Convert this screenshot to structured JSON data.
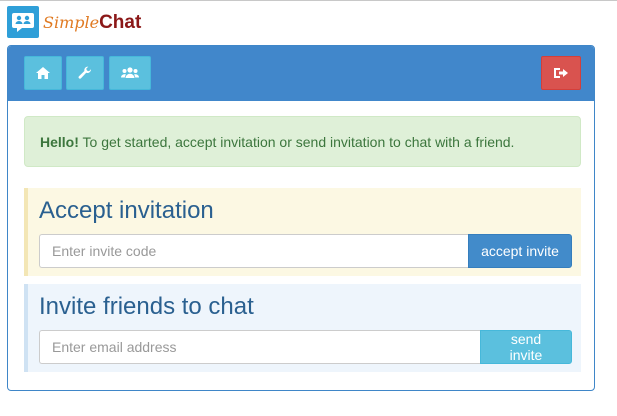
{
  "brand": {
    "simple": "Simple",
    "chat": "Chat"
  },
  "toolbar": {
    "icons": [
      "home-icon",
      "wrench-icon",
      "users-icon",
      "logout-icon"
    ]
  },
  "alert": {
    "strong": "Hello!",
    "text": " To get started, accept invitation or send invitation to chat with a friend."
  },
  "accept": {
    "title": "Accept invitation",
    "placeholder": "Enter invite code",
    "button": "accept invite"
  },
  "invite": {
    "title": "Invite friends to chat",
    "placeholder": "Enter email address",
    "button": "send invite"
  },
  "colors": {
    "header": "#4187cb",
    "info_button": "#5bc0de",
    "danger_button": "#d9534f",
    "primary_button": "#428bca",
    "alert_bg": "#dff0d8"
  }
}
